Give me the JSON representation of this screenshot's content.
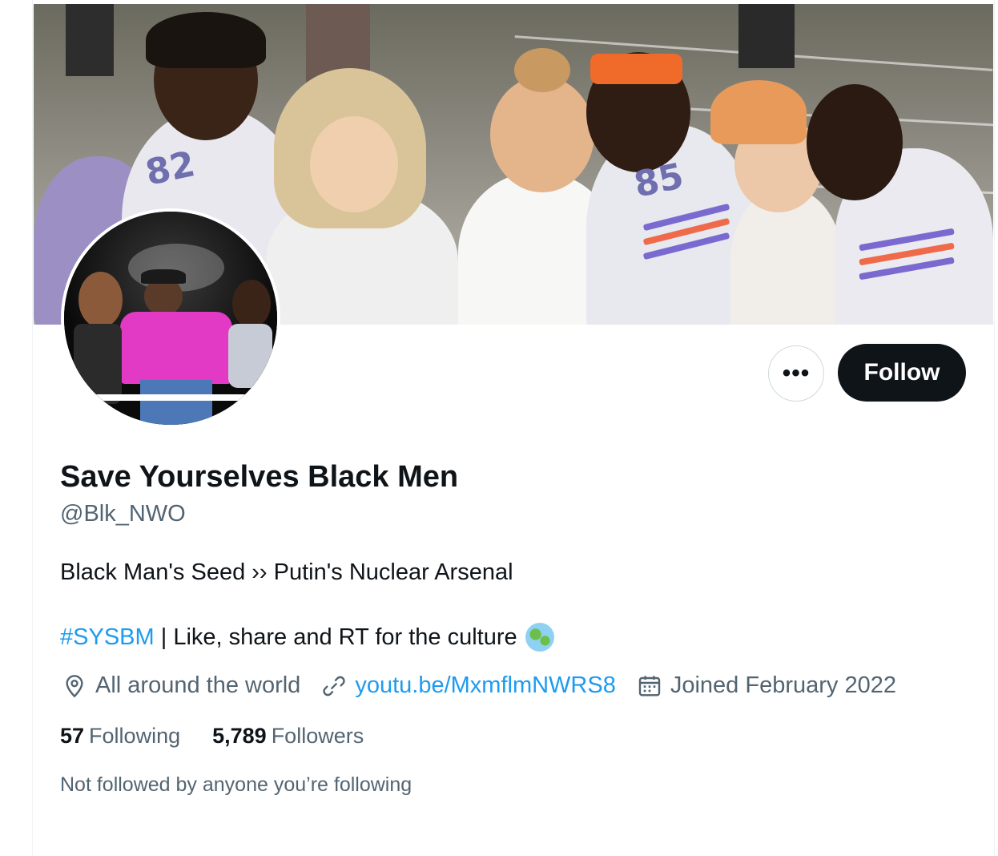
{
  "profile": {
    "display_name": "Save Yourselves Black Men",
    "handle": "@Blk_NWO",
    "bio_line1": "Black Man's Seed ›› Putin's Nuclear Arsenal",
    "bio_hashtag": "#SYSBM",
    "bio_line2_rest": " | Like, share and RT for the culture",
    "bio_emoji_icon": "globe-asia-icon",
    "location": "All around the world",
    "website": "youtu.be/MxmflmNWRS8",
    "joined": "Joined February 2022",
    "following_count": "57",
    "following_label": "Following",
    "followers_count": "5,789",
    "followers_label": "Followers",
    "not_followed_text": "Not followed by anyone you’re following"
  },
  "actions": {
    "more_label": "•••",
    "follow_label": "Follow"
  },
  "icons": {
    "location": "location-pin-icon",
    "website": "link-icon",
    "joined": "calendar-icon"
  },
  "colors": {
    "link": "#1d9bf0",
    "text_primary": "#0f1419",
    "text_secondary": "#536471",
    "follow_button_bg": "#0f1419"
  }
}
